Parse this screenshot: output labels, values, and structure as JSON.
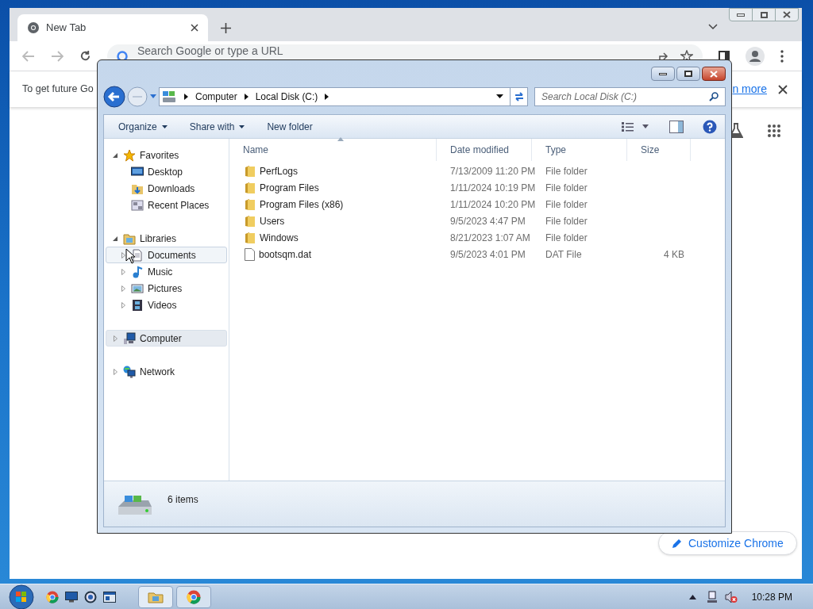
{
  "browser": {
    "tab": {
      "title": "New Tab"
    },
    "omnibox": {
      "placeholder": "Search Google or type a URL"
    },
    "infobar": {
      "message": "To get future Go",
      "link": "n more"
    },
    "customize_button": "Customize Chrome"
  },
  "explorer": {
    "breadcrumb": [
      "Computer",
      "Local Disk (C:)"
    ],
    "search": {
      "placeholder": "Search Local Disk (C:)"
    },
    "toolbar": [
      {
        "label": "Organize",
        "dropdown": true
      },
      {
        "label": "Share with",
        "dropdown": true
      },
      {
        "label": "New folder",
        "dropdown": false
      }
    ],
    "nav": [
      {
        "label": "Favorites",
        "expanded": true,
        "selected": false,
        "hovered": false,
        "children": [
          {
            "label": "Desktop",
            "selected": false,
            "hovered": false
          },
          {
            "label": "Downloads",
            "selected": false,
            "hovered": false
          },
          {
            "label": "Recent Places",
            "selected": false,
            "hovered": false
          }
        ]
      },
      {
        "label": "Libraries",
        "expanded": true,
        "selected": false,
        "hovered": false,
        "children": [
          {
            "label": "Documents",
            "expanded": false,
            "selected": false,
            "hovered": true
          },
          {
            "label": "Music",
            "expanded": false,
            "selected": false,
            "hovered": false
          },
          {
            "label": "Pictures",
            "expanded": false,
            "selected": false,
            "hovered": false
          },
          {
            "label": "Videos",
            "expanded": false,
            "selected": false,
            "hovered": false
          }
        ]
      },
      {
        "label": "Computer",
        "expanded": false,
        "selected": true,
        "hovered": false
      },
      {
        "label": "Network",
        "expanded": false,
        "selected": false,
        "hovered": false
      }
    ],
    "columns": [
      "Name",
      "Date modified",
      "Type",
      "Size"
    ],
    "files": [
      {
        "name": "PerfLogs",
        "kind": "folder",
        "date": "7/13/2009 11:20 PM",
        "type": "File folder"
      },
      {
        "name": "Program Files",
        "kind": "folder",
        "date": "1/11/2024 10:19 PM",
        "type": "File folder"
      },
      {
        "name": "Program Files (x86)",
        "kind": "folder",
        "date": "1/11/2024 10:20 PM",
        "type": "File folder"
      },
      {
        "name": "Users",
        "kind": "folder",
        "date": "9/5/2023 4:47 PM",
        "type": "File folder"
      },
      {
        "name": "Windows",
        "kind": "folder",
        "date": "8/21/2023 1:07 AM",
        "type": "File folder"
      },
      {
        "name": "bootsqm.dat",
        "kind": "file",
        "date": "9/5/2023 4:01 PM",
        "type": "DAT File",
        "size": "4 KB"
      }
    ],
    "status": "6 items"
  },
  "taskbar": {
    "clock": "10:28 PM"
  }
}
